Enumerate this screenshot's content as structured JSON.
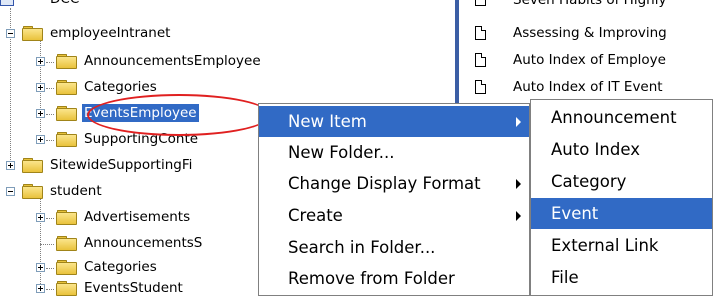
{
  "tree": {
    "top_item": "DCC",
    "items": [
      {
        "label": "employeeIntranet"
      },
      {
        "label": "AnnouncementsEmployee"
      },
      {
        "label": "Categories"
      },
      {
        "label": "EventsEmployee"
      },
      {
        "label": "SupportingConte"
      },
      {
        "label": "SitewideSupportingFi"
      },
      {
        "label": "student"
      },
      {
        "label": "Advertisements"
      },
      {
        "label": "AnnouncementsS"
      },
      {
        "label": "Categories"
      },
      {
        "label": "EventsStudent"
      }
    ]
  },
  "right_panel": {
    "items": [
      {
        "label": "Seven Habits of Highly"
      },
      {
        "label": "Assessing & Improving"
      },
      {
        "label": "Auto Index of Employe"
      },
      {
        "label": "Auto Index of IT Event"
      }
    ]
  },
  "context_menu": {
    "items": [
      {
        "label": "New Item"
      },
      {
        "label": "New Folder..."
      },
      {
        "label": "Change Display Format"
      },
      {
        "label": "Create"
      },
      {
        "label": "Search in Folder..."
      },
      {
        "label": "Remove from Folder"
      }
    ]
  },
  "submenu": {
    "items": [
      {
        "label": "Announcement"
      },
      {
        "label": "Auto Index"
      },
      {
        "label": "Category"
      },
      {
        "label": "Event"
      },
      {
        "label": "External Link"
      },
      {
        "label": "File"
      }
    ]
  },
  "colors": {
    "selection": "#316ac5",
    "highlight_ellipse": "#e02020",
    "separator": "#3b5ea5"
  }
}
